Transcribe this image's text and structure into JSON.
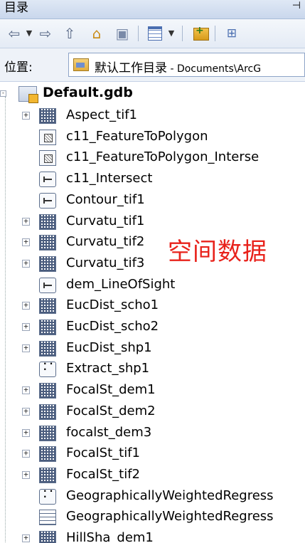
{
  "window": {
    "title": "目录",
    "pin_icon": "pin-icon"
  },
  "toolbar": {
    "icons": [
      "back-arrow-icon",
      "back-dropdown-icon",
      "forward-arrow-icon",
      "up-folder-icon",
      "home-icon",
      "connect-folder-icon",
      "view-toggle-icon",
      "view-dropdown-icon",
      "add-folder-icon",
      "tree-view-icon"
    ]
  },
  "location": {
    "label": "位置:",
    "value_cn": "默认工作目录",
    "value_rest": " - Documents\\ArcG"
  },
  "tree": {
    "root": {
      "label": "Default.gdb",
      "expander": "-"
    },
    "items": [
      {
        "label": "Aspect_tif1",
        "type": "raster",
        "expandable": true
      },
      {
        "label": "c11_FeatureToPolygon",
        "type": "polygon",
        "expandable": false
      },
      {
        "label": "c11_FeatureToPolygon_Interse",
        "type": "polygon",
        "expandable": false
      },
      {
        "label": "c11_Intersect",
        "type": "line",
        "expandable": false
      },
      {
        "label": "Contour_tif1",
        "type": "line",
        "expandable": false
      },
      {
        "label": "Curvatu_tif1",
        "type": "raster",
        "expandable": true
      },
      {
        "label": "Curvatu_tif2",
        "type": "raster",
        "expandable": true
      },
      {
        "label": "Curvatu_tif3",
        "type": "raster",
        "expandable": true
      },
      {
        "label": "dem_LineOfSight",
        "type": "line",
        "expandable": false
      },
      {
        "label": "EucDist_scho1",
        "type": "raster",
        "expandable": true
      },
      {
        "label": "EucDist_scho2",
        "type": "raster",
        "expandable": true
      },
      {
        "label": "EucDist_shp1",
        "type": "raster",
        "expandable": true
      },
      {
        "label": "Extract_shp1",
        "type": "point",
        "expandable": false
      },
      {
        "label": "FocalSt_dem1",
        "type": "raster",
        "expandable": true
      },
      {
        "label": "FocalSt_dem2",
        "type": "raster",
        "expandable": true
      },
      {
        "label": "focalst_dem3",
        "type": "raster",
        "expandable": true
      },
      {
        "label": "FocalSt_tif1",
        "type": "raster",
        "expandable": true
      },
      {
        "label": "FocalSt_tif2",
        "type": "raster",
        "expandable": true
      },
      {
        "label": "GeographicallyWeightedRegress",
        "type": "point",
        "expandable": false
      },
      {
        "label": "GeographicallyWeightedRegress",
        "type": "table",
        "expandable": false
      },
      {
        "label": "HillSha_dem1",
        "type": "raster",
        "expandable": true
      }
    ]
  },
  "annotation": {
    "text": "空间数据",
    "color": "#e8221b"
  }
}
